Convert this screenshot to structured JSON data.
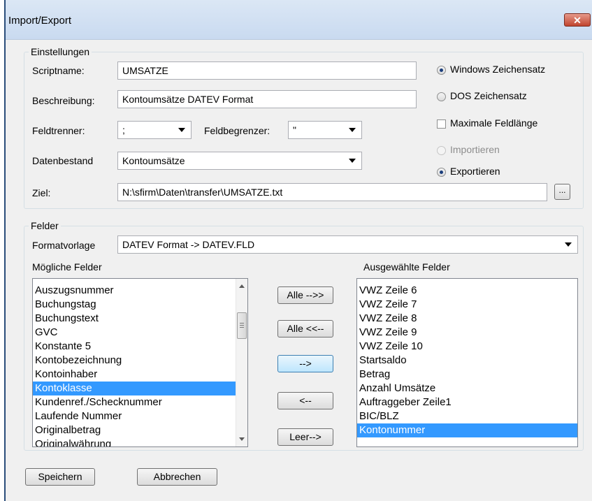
{
  "window": {
    "title": "Import/Export",
    "close_label": "✕"
  },
  "einstellungen": {
    "legend": "Einstellungen",
    "scriptname_label": "Scriptname:",
    "scriptname_value": "UMSATZE",
    "beschreibung_label": "Beschreibung:",
    "beschreibung_value": "Kontoumsätze DATEV Format",
    "feldtrenner_label": "Feldtrenner:",
    "feldtrenner_value": ";",
    "feldbegrenzer_label": "Feldbegrenzer:",
    "feldbegrenzer_value": "\"",
    "datenbestand_label": "Datenbestand",
    "datenbestand_value": "Kontoumsätze",
    "ziel_label": "Ziel:",
    "ziel_value": "N:\\sfirm\\Daten\\transfer\\UMSATZE.txt",
    "browse_label": "...",
    "windows_zeichensatz_label": "Windows Zeichensatz",
    "dos_zeichensatz_label": "DOS Zeichensatz",
    "maximale_feldlaenge_label": "Maximale Feldlänge",
    "importieren_label": "Importieren",
    "exportieren_label": "Exportieren"
  },
  "felder": {
    "legend": "Felder",
    "formatvorlage_label": "Formatvorlage",
    "formatvorlage_value": "DATEV Format -> DATEV.FLD",
    "moegliche_label": "Mögliche Felder",
    "ausgewaehlte_label": "Ausgewählte Felder",
    "moegliche_items": [
      "Auszugsnummer",
      "Buchungstag",
      "Buchungstext",
      "GVC",
      "Konstante 5",
      "Kontobezeichnung",
      "Kontoinhaber",
      "Kontoklasse",
      "Kundenref./Schecknummer",
      "Laufende Nummer",
      "Originalbetrag",
      "Originalwährung"
    ],
    "moegliche_selected": "Kontoklasse",
    "ausgewaehlte_items": [
      "VWZ Zeile 6",
      "VWZ Zeile 7",
      "VWZ Zeile 8",
      "VWZ Zeile 9",
      "VWZ Zeile 10",
      "Startsaldo",
      "Betrag",
      "Anzahl Umsätze",
      "Auftraggeber Zeile1",
      "BIC/BLZ",
      "Kontonummer"
    ],
    "ausgewaehlte_selected": "Kontonummer",
    "btn_alle_rechts": "Alle -->>",
    "btn_alle_links": "Alle <<--",
    "btn_rechts": "-->",
    "btn_links": "<--",
    "btn_leer": "Leer-->"
  },
  "footer": {
    "speichern_label": "Speichern",
    "abbrechen_label": "Abbrechen"
  }
}
